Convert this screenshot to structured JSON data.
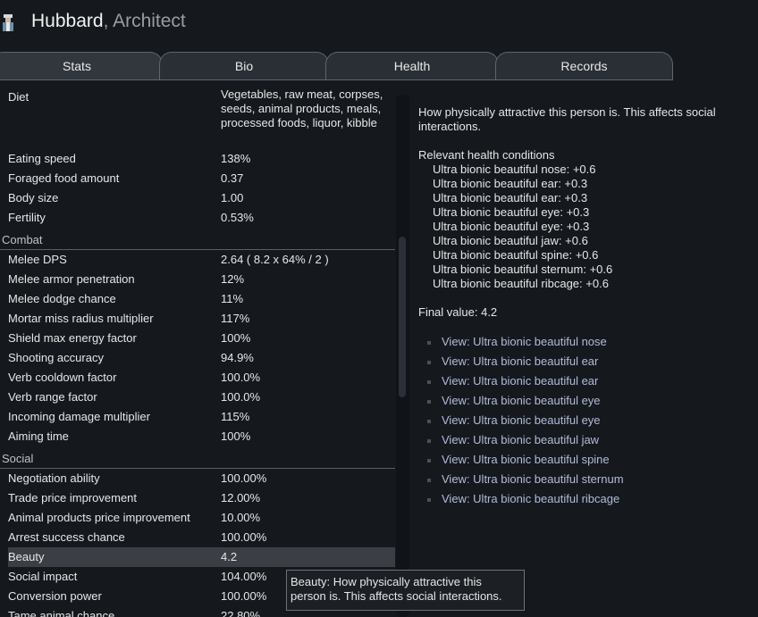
{
  "header": {
    "name": "Hubbard",
    "separator": ", ",
    "role": "Architect"
  },
  "tabs": [
    {
      "label": "Stats",
      "active": true
    },
    {
      "label": "Bio",
      "active": false
    },
    {
      "label": "Health",
      "active": false
    },
    {
      "label": "Records",
      "active": false
    }
  ],
  "stats": {
    "diet": {
      "label": "Diet",
      "value": "Vegetables, raw meat, corpses, seeds, animal products, meals, processed foods, liquor, kibble"
    },
    "basics": [
      {
        "label": "Eating speed",
        "value": "138%"
      },
      {
        "label": "Foraged food amount",
        "value": "0.37"
      },
      {
        "label": "Body size",
        "value": "1.00"
      },
      {
        "label": "Fertility",
        "value": "0.53%"
      }
    ],
    "combat_title": "Combat",
    "combat": [
      {
        "label": "Melee DPS",
        "value": "2.64 ( 8.2 x 64% / 2 )"
      },
      {
        "label": "Melee armor penetration",
        "value": "12%"
      },
      {
        "label": "Melee dodge chance",
        "value": "11%"
      },
      {
        "label": "Mortar miss radius multiplier",
        "value": "117%"
      },
      {
        "label": "Shield max energy factor",
        "value": "100%"
      },
      {
        "label": "Shooting accuracy",
        "value": "94.9%"
      },
      {
        "label": "Verb cooldown factor",
        "value": "100.0%"
      },
      {
        "label": "Verb range factor",
        "value": "100.0%"
      },
      {
        "label": "Incoming damage multiplier",
        "value": "115%"
      },
      {
        "label": "Aiming time",
        "value": "100%"
      }
    ],
    "social_title": "Social",
    "social": [
      {
        "label": "Negotiation ability",
        "value": "100.00%"
      },
      {
        "label": "Trade price improvement",
        "value": "12.00%"
      },
      {
        "label": "Animal products price improvement",
        "value": "10.00%"
      },
      {
        "label": "Arrest success chance",
        "value": "100.00%"
      },
      {
        "label": "Beauty",
        "value": "4.2"
      },
      {
        "label": "Social impact",
        "value": "104.00%"
      },
      {
        "label": "Conversion power",
        "value": "100.00%"
      },
      {
        "label": "Tame animal chance",
        "value": "22.80%"
      }
    ]
  },
  "detail": {
    "description": "How physically attractive this person is. This affects social interactions.",
    "conditions_title": "Relevant health conditions",
    "conditions": [
      "Ultra bionic beautiful nose: +0.6",
      "Ultra bionic beautiful ear: +0.3",
      "Ultra bionic beautiful ear: +0.3",
      "Ultra bionic beautiful eye: +0.3",
      "Ultra bionic beautiful eye: +0.3",
      "Ultra bionic beautiful jaw: +0.6",
      "Ultra bionic beautiful spine: +0.6",
      "Ultra bionic beautiful sternum: +0.6",
      "Ultra bionic beautiful ribcage: +0.6"
    ],
    "final_value": "Final value: 4.2",
    "links": [
      "View: Ultra bionic beautiful nose",
      "View: Ultra bionic beautiful ear",
      "View: Ultra bionic beautiful ear",
      "View: Ultra bionic beautiful eye",
      "View: Ultra bionic beautiful eye",
      "View: Ultra bionic beautiful jaw",
      "View: Ultra bionic beautiful spine",
      "View: Ultra bionic beautiful sternum",
      "View: Ultra bionic beautiful ribcage"
    ]
  },
  "tooltip": {
    "text": "Beauty: How physically attractive this person is. This affects social interactions."
  }
}
